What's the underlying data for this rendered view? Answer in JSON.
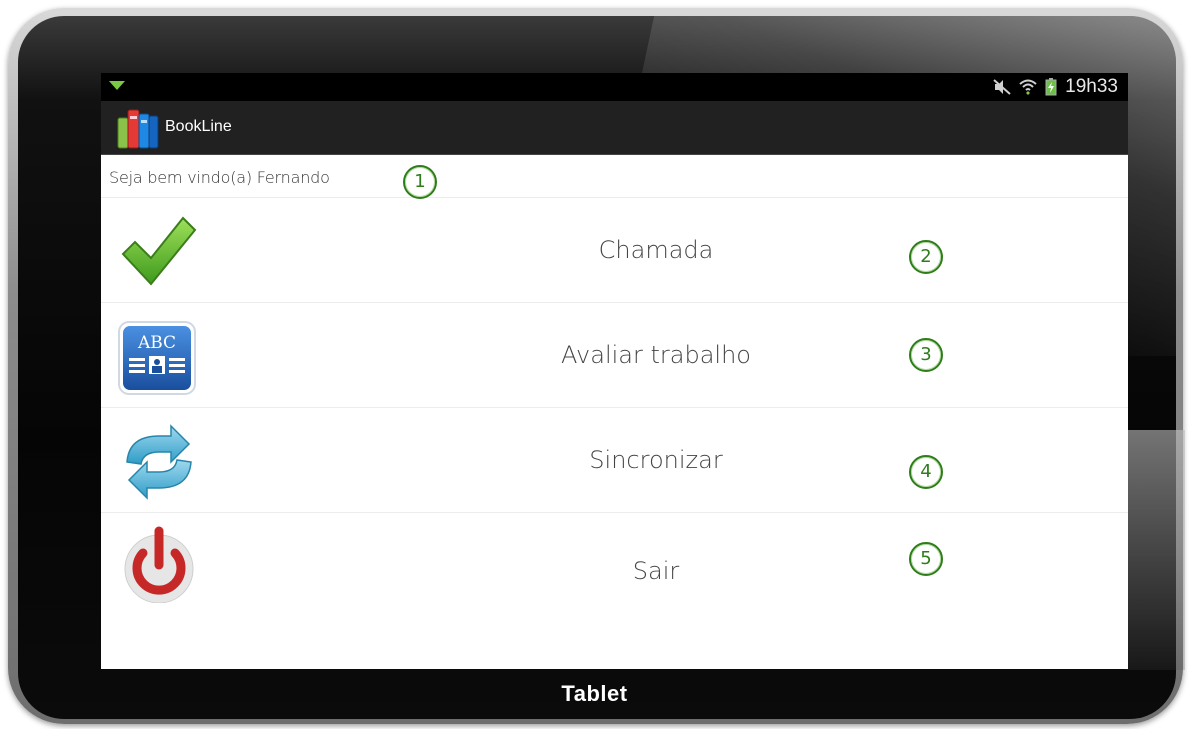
{
  "device": {
    "label": "Tablet"
  },
  "status_bar": {
    "time": "19h33",
    "icons": [
      "download-notification-icon",
      "mute-icon",
      "wifi-icon",
      "battery-charging-icon"
    ]
  },
  "action_bar": {
    "app_title": "BookLine",
    "app_icon": "books-logo-icon"
  },
  "welcome": {
    "text": "Seja bem vindo(a) Fernando",
    "badge": "1"
  },
  "menu": {
    "items": [
      {
        "label": "Chamada",
        "icon": "checkmark-icon",
        "badge": "2"
      },
      {
        "label": "Avaliar trabalho",
        "icon": "abc-card-icon",
        "badge": "3"
      },
      {
        "label": "Sincronizar",
        "icon": "sync-arrows-icon",
        "badge": "4"
      },
      {
        "label": "Sair",
        "icon": "power-icon",
        "badge": "5"
      }
    ]
  },
  "colors": {
    "badge_green": "#2e7d1a",
    "action_bar": "#212121",
    "status_bar": "#000000"
  }
}
